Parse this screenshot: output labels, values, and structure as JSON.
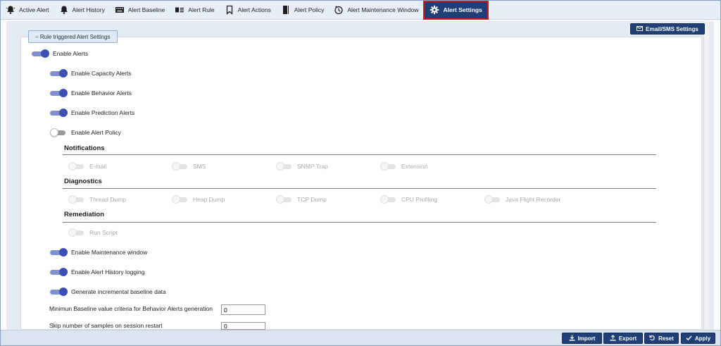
{
  "tabs": [
    {
      "label": "Active Alert",
      "icon": "alert-bell-icon"
    },
    {
      "label": "Alert History",
      "icon": "bell-icon"
    },
    {
      "label": "Alert Baseline",
      "icon": "keyboard-icon"
    },
    {
      "label": "Alert Rule",
      "icon": "rule-list-icon"
    },
    {
      "label": "Alert Actions",
      "icon": "bookmark-icon"
    },
    {
      "label": "Alert Policy",
      "icon": "notebook-icon"
    },
    {
      "label": "Alert Maintenance Window",
      "icon": "clock-icon"
    },
    {
      "label": "Alert Settings",
      "icon": "gear-icon",
      "active": true
    }
  ],
  "group": {
    "legend": "− Rule triggered Alert Settings"
  },
  "email_button": "Email/SMS Settings",
  "toggles": {
    "enable_alerts": {
      "label": "Enable Alerts",
      "state": "on"
    },
    "capacity": {
      "label": "Enable Capacity Alerts",
      "state": "on"
    },
    "behavior": {
      "label": "Enable Behavior Alerts",
      "state": "on"
    },
    "prediction": {
      "label": "Enable Prediction Alerts",
      "state": "on"
    },
    "policy": {
      "label": "Enable Alert Policy",
      "state": "off"
    },
    "maintenance": {
      "label": "Enable Maintenance window",
      "state": "on"
    },
    "history_logging": {
      "label": "Enable Alert History logging",
      "state": "on"
    },
    "baseline": {
      "label": "Generate incremental baseline data",
      "state": "on"
    }
  },
  "notifications": {
    "title": "Notifications",
    "items": [
      "E-mail",
      "SMS",
      "SNMP Trap",
      "Extension"
    ]
  },
  "diagnostics": {
    "title": "Diagnostics",
    "items": [
      "Thread Dump",
      "Heap Dump",
      "TCP Dump",
      "CPU Profiling",
      "Java Flight Recorder"
    ]
  },
  "remediation": {
    "title": "Remediation",
    "items": [
      "Run Script"
    ]
  },
  "fields": {
    "min_baseline": {
      "label": "Minimun Baseline value criteria for Behavior Alerts generation",
      "value": "0"
    },
    "skip_samples": {
      "label": "Skip number of samples on session restart",
      "value": "0"
    }
  },
  "footer": {
    "import": "Import",
    "export": "Export",
    "reset": "Reset",
    "apply": "Apply"
  },
  "colors": {
    "accent": "#1f3f76",
    "toggle_on": "#3d4fb4",
    "active_tab_border": "#d11a1a"
  }
}
